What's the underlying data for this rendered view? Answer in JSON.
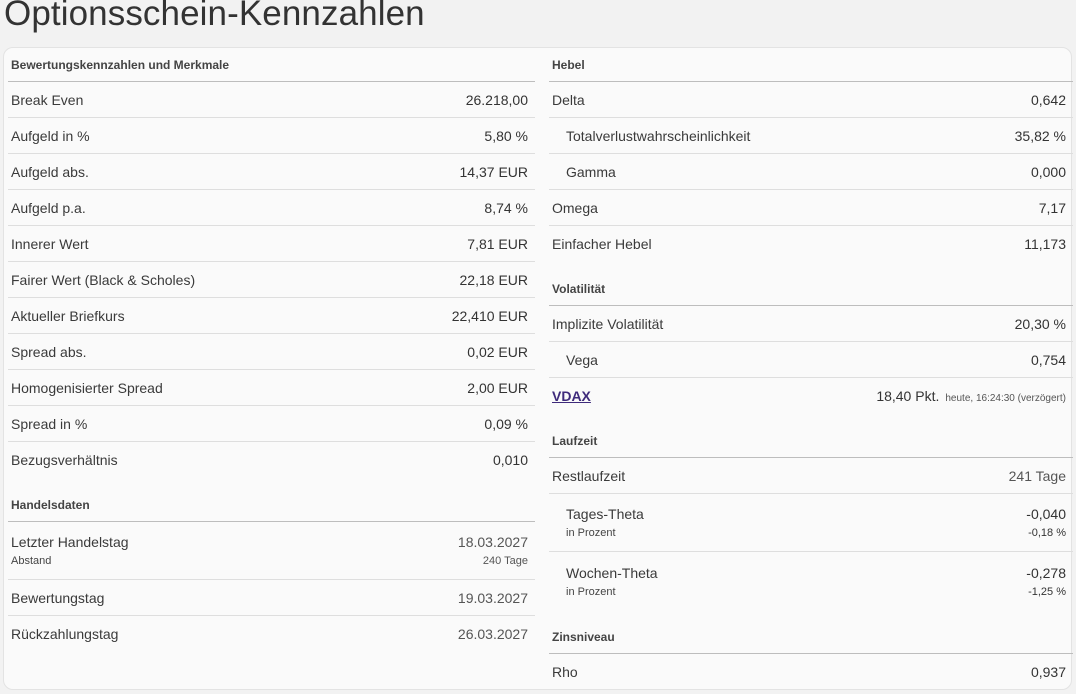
{
  "page_title": "Optionsschein-Kennzahlen",
  "left": {
    "bewertung": {
      "title": "Bewertungskennzahlen und Merkmale",
      "rows": [
        {
          "label": "Break Even",
          "value": "26.218,00"
        },
        {
          "label": "Aufgeld in %",
          "value": "5,80 %"
        },
        {
          "label": "Aufgeld abs.",
          "value": "14,37 EUR"
        },
        {
          "label": "Aufgeld p.a.",
          "value": "8,74 %"
        },
        {
          "label": "Innerer Wert",
          "value": "7,81 EUR"
        },
        {
          "label": "Fairer Wert (Black & Scholes)",
          "value": "22,18 EUR"
        },
        {
          "label": "Aktueller Briefkurs",
          "value": "22,410 EUR"
        },
        {
          "label": "Spread abs.",
          "value": "0,02 EUR"
        },
        {
          "label": "Homogenisierter Spread",
          "value": "2,00 EUR"
        },
        {
          "label": "Spread in %",
          "value": "0,09 %"
        },
        {
          "label": "Bezugsverhältnis",
          "value": "0,010"
        }
      ]
    },
    "handel": {
      "title": "Handelsdaten",
      "letzter": {
        "label": "Letzter Handelstag",
        "value": "18.03.2027",
        "sub_label": "Abstand",
        "sub_value": "240 Tage"
      },
      "bewertungstag": {
        "label": "Bewertungstag",
        "value": "19.03.2027"
      },
      "rueckzahlung": {
        "label": "Rückzahlungstag",
        "value": "26.03.2027"
      }
    }
  },
  "right": {
    "hebel": {
      "title": "Hebel",
      "rows": [
        {
          "label": "Delta",
          "value": "0,642"
        },
        {
          "label": "Totalverlustwahrscheinlichkeit",
          "value": "35,82 %"
        },
        {
          "label": "Gamma",
          "value": "0,000"
        },
        {
          "label": "Omega",
          "value": "7,17"
        },
        {
          "label": "Einfacher Hebel",
          "value": "11,173"
        }
      ]
    },
    "volatilitaet": {
      "title": "Volatilität",
      "implizit": {
        "label": "Implizite Volatilität",
        "value": "20,30 %"
      },
      "vega": {
        "label": "Vega",
        "value": "0,754"
      },
      "vdax": {
        "label": "VDAX",
        "value": "18,40 Pkt.",
        "time": "heute, 16:24:30 (verzögert)"
      }
    },
    "laufzeit": {
      "title": "Laufzeit",
      "rest": {
        "label": "Restlaufzeit",
        "value": "241 Tage"
      },
      "tages_theta": {
        "label": "Tages-Theta",
        "value": "-0,040",
        "sub_label": "in Prozent",
        "sub_value": "-0,18 %"
      },
      "wochen_theta": {
        "label": "Wochen-Theta",
        "value": "-0,278",
        "sub_label": "in Prozent",
        "sub_value": "-1,25 %"
      }
    },
    "zins": {
      "title": "Zinsniveau",
      "rho": {
        "label": "Rho",
        "value": "0,937"
      }
    }
  }
}
